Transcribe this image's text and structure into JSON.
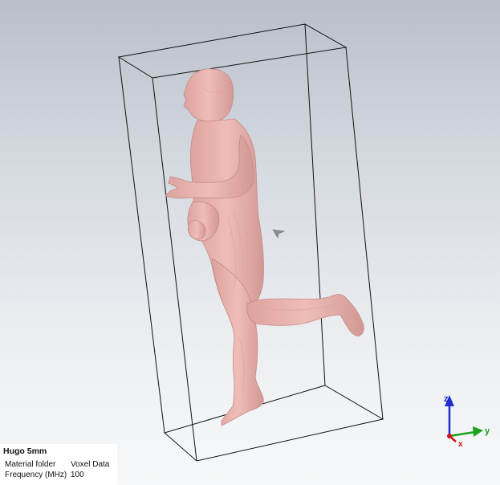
{
  "info_panel": {
    "title": "Hugo 5mm",
    "rows": [
      {
        "key": "Material folder",
        "value": "Voxel Data"
      },
      {
        "key": "Frequency (MHz)",
        "value": "100"
      }
    ]
  },
  "axes": {
    "z_label": "z",
    "y_label": "y",
    "x_label": "x",
    "z_color": "#1f2fd0",
    "y_color": "#1aa11a",
    "x_color": "#d01515"
  },
  "colors": {
    "body_fill": "#e9b3ae",
    "body_shade": "#c98f8a",
    "bbox_stroke": "#111111"
  },
  "icons": [
    "cursor-icon"
  ]
}
